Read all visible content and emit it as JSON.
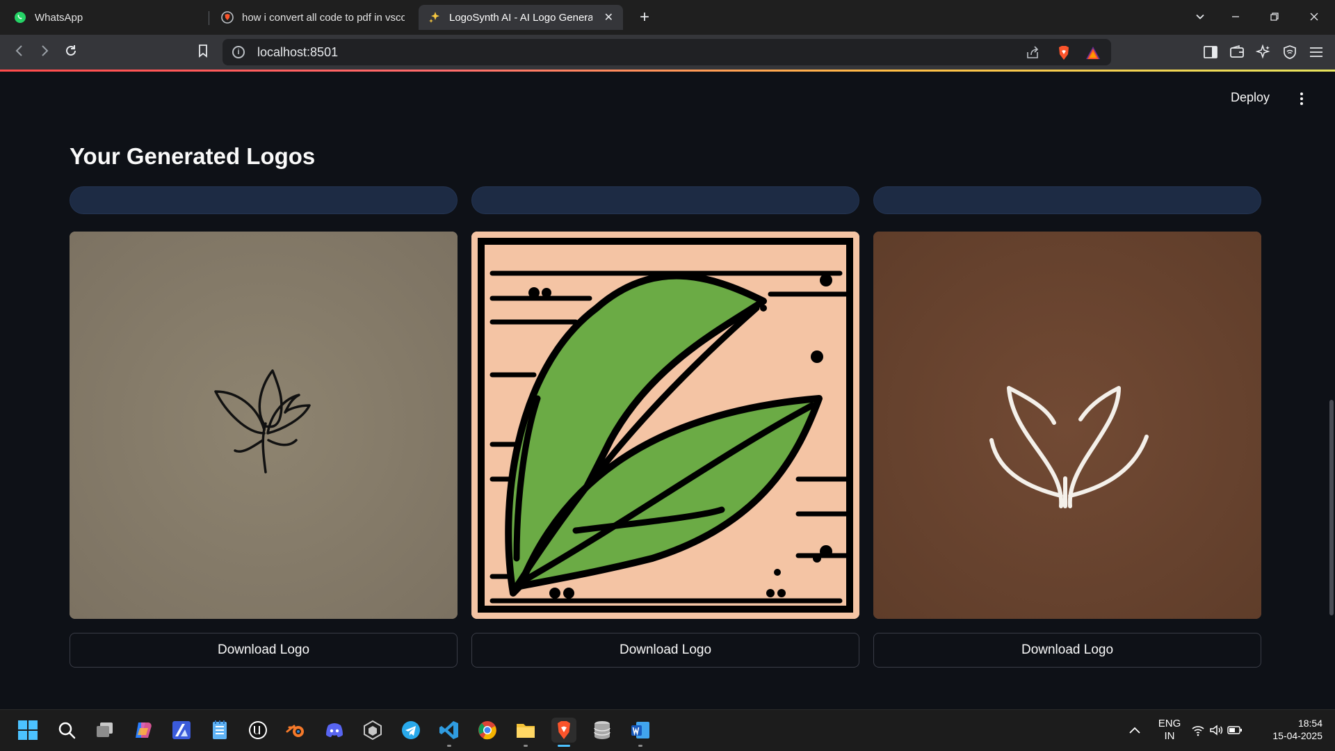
{
  "browser": {
    "tabs": [
      {
        "label": "WhatsApp",
        "icon": "whatsapp-icon"
      },
      {
        "label": "how i convert all code to pdf in vsco",
        "icon": "brave-search-icon"
      },
      {
        "label": "LogoSynth AI - AI Logo Genera",
        "icon": "sparkles-icon",
        "active": true
      }
    ],
    "url": "localhost:8501"
  },
  "app": {
    "deploy_label": "Deploy",
    "heading": "Your Generated Logos",
    "logos": [
      {
        "download_label": "Download Logo",
        "background": "#867c6b",
        "icon": "sketch-leaf-logo"
      },
      {
        "download_label": "Download Logo",
        "background": "#f2c0a0",
        "icon": "green-leaf-logo"
      },
      {
        "download_label": "Download Logo",
        "background": "#6b4530",
        "icon": "white-tulip-logo"
      }
    ]
  },
  "taskbar": {
    "apps": [
      "start-icon",
      "search-icon",
      "task-view-icon",
      "copilot-icon",
      "affinity-icon",
      "notepad-icon",
      "unreal-engine-icon",
      "blender-icon",
      "discord-icon",
      "unity-icon",
      "telegram-icon",
      "vscode-icon",
      "chrome-icon",
      "file-explorer-icon",
      "brave-icon",
      "database-icon",
      "word-icon"
    ],
    "lang_top": "ENG",
    "lang_bottom": "IN",
    "time": "18:54",
    "date": "15-04-2025"
  },
  "colors": {
    "app_bg": "#0e1117",
    "pill_bg": "#1d2b44",
    "accent": "#ff4b4b"
  }
}
